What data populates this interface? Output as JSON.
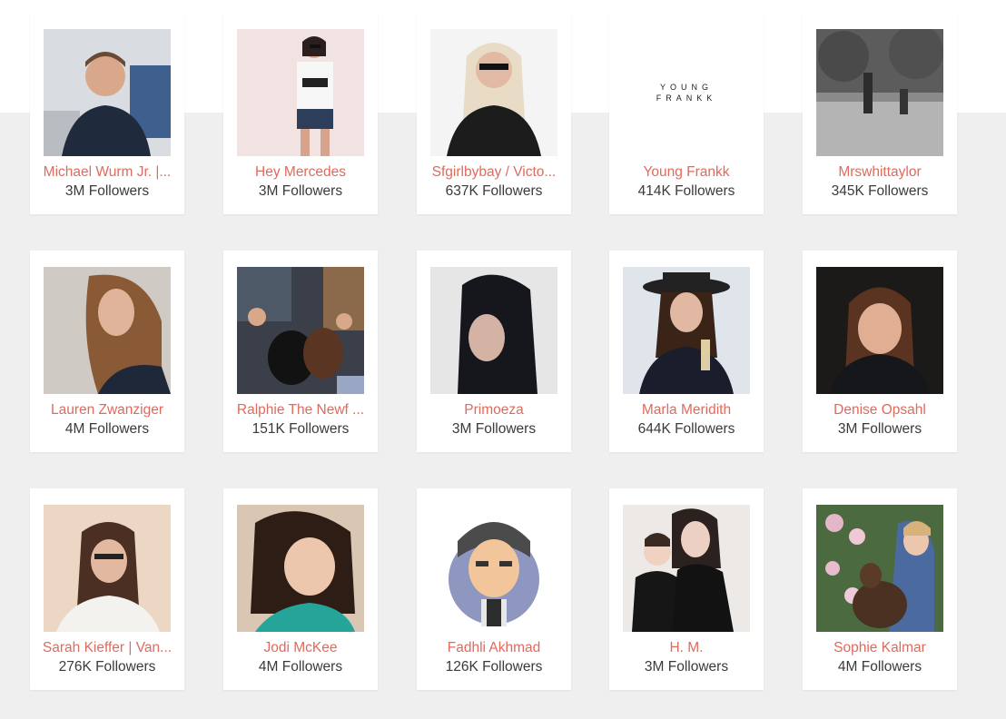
{
  "influencers": [
    {
      "name": "Michael Wurm Jr. |...",
      "followers": "3M Followers"
    },
    {
      "name": "Hey Mercedes",
      "followers": "3M Followers"
    },
    {
      "name": "Sfgirlbybay / Victo...",
      "followers": "637K Followers"
    },
    {
      "name": "Young Frankk",
      "followers": "414K Followers",
      "logo_line1": "YOUNG",
      "logo_line2": "FRANKK"
    },
    {
      "name": "Mrswhittaylor",
      "followers": "345K Followers"
    },
    {
      "name": "Lauren Zwanziger",
      "followers": "4M Followers"
    },
    {
      "name": "Ralphie The Newf ...",
      "followers": "151K Followers"
    },
    {
      "name": "Primoeza",
      "followers": "3M Followers"
    },
    {
      "name": "Marla Meridith",
      "followers": "644K Followers"
    },
    {
      "name": "Denise Opsahl",
      "followers": "3M Followers"
    },
    {
      "name": "Sarah Kieffer | Van...",
      "followers": "276K Followers"
    },
    {
      "name": "Jodi McKee",
      "followers": "4M Followers"
    },
    {
      "name": "Fadhli Akhmad",
      "followers": "126K Followers"
    },
    {
      "name": "H. M.",
      "followers": "3M Followers"
    },
    {
      "name": "Sophie Kalmar",
      "followers": "4M Followers"
    }
  ],
  "colors": {
    "name_link": "#e06a5c",
    "followers_text": "#3a3a3a",
    "page_bg": "#efefef"
  }
}
